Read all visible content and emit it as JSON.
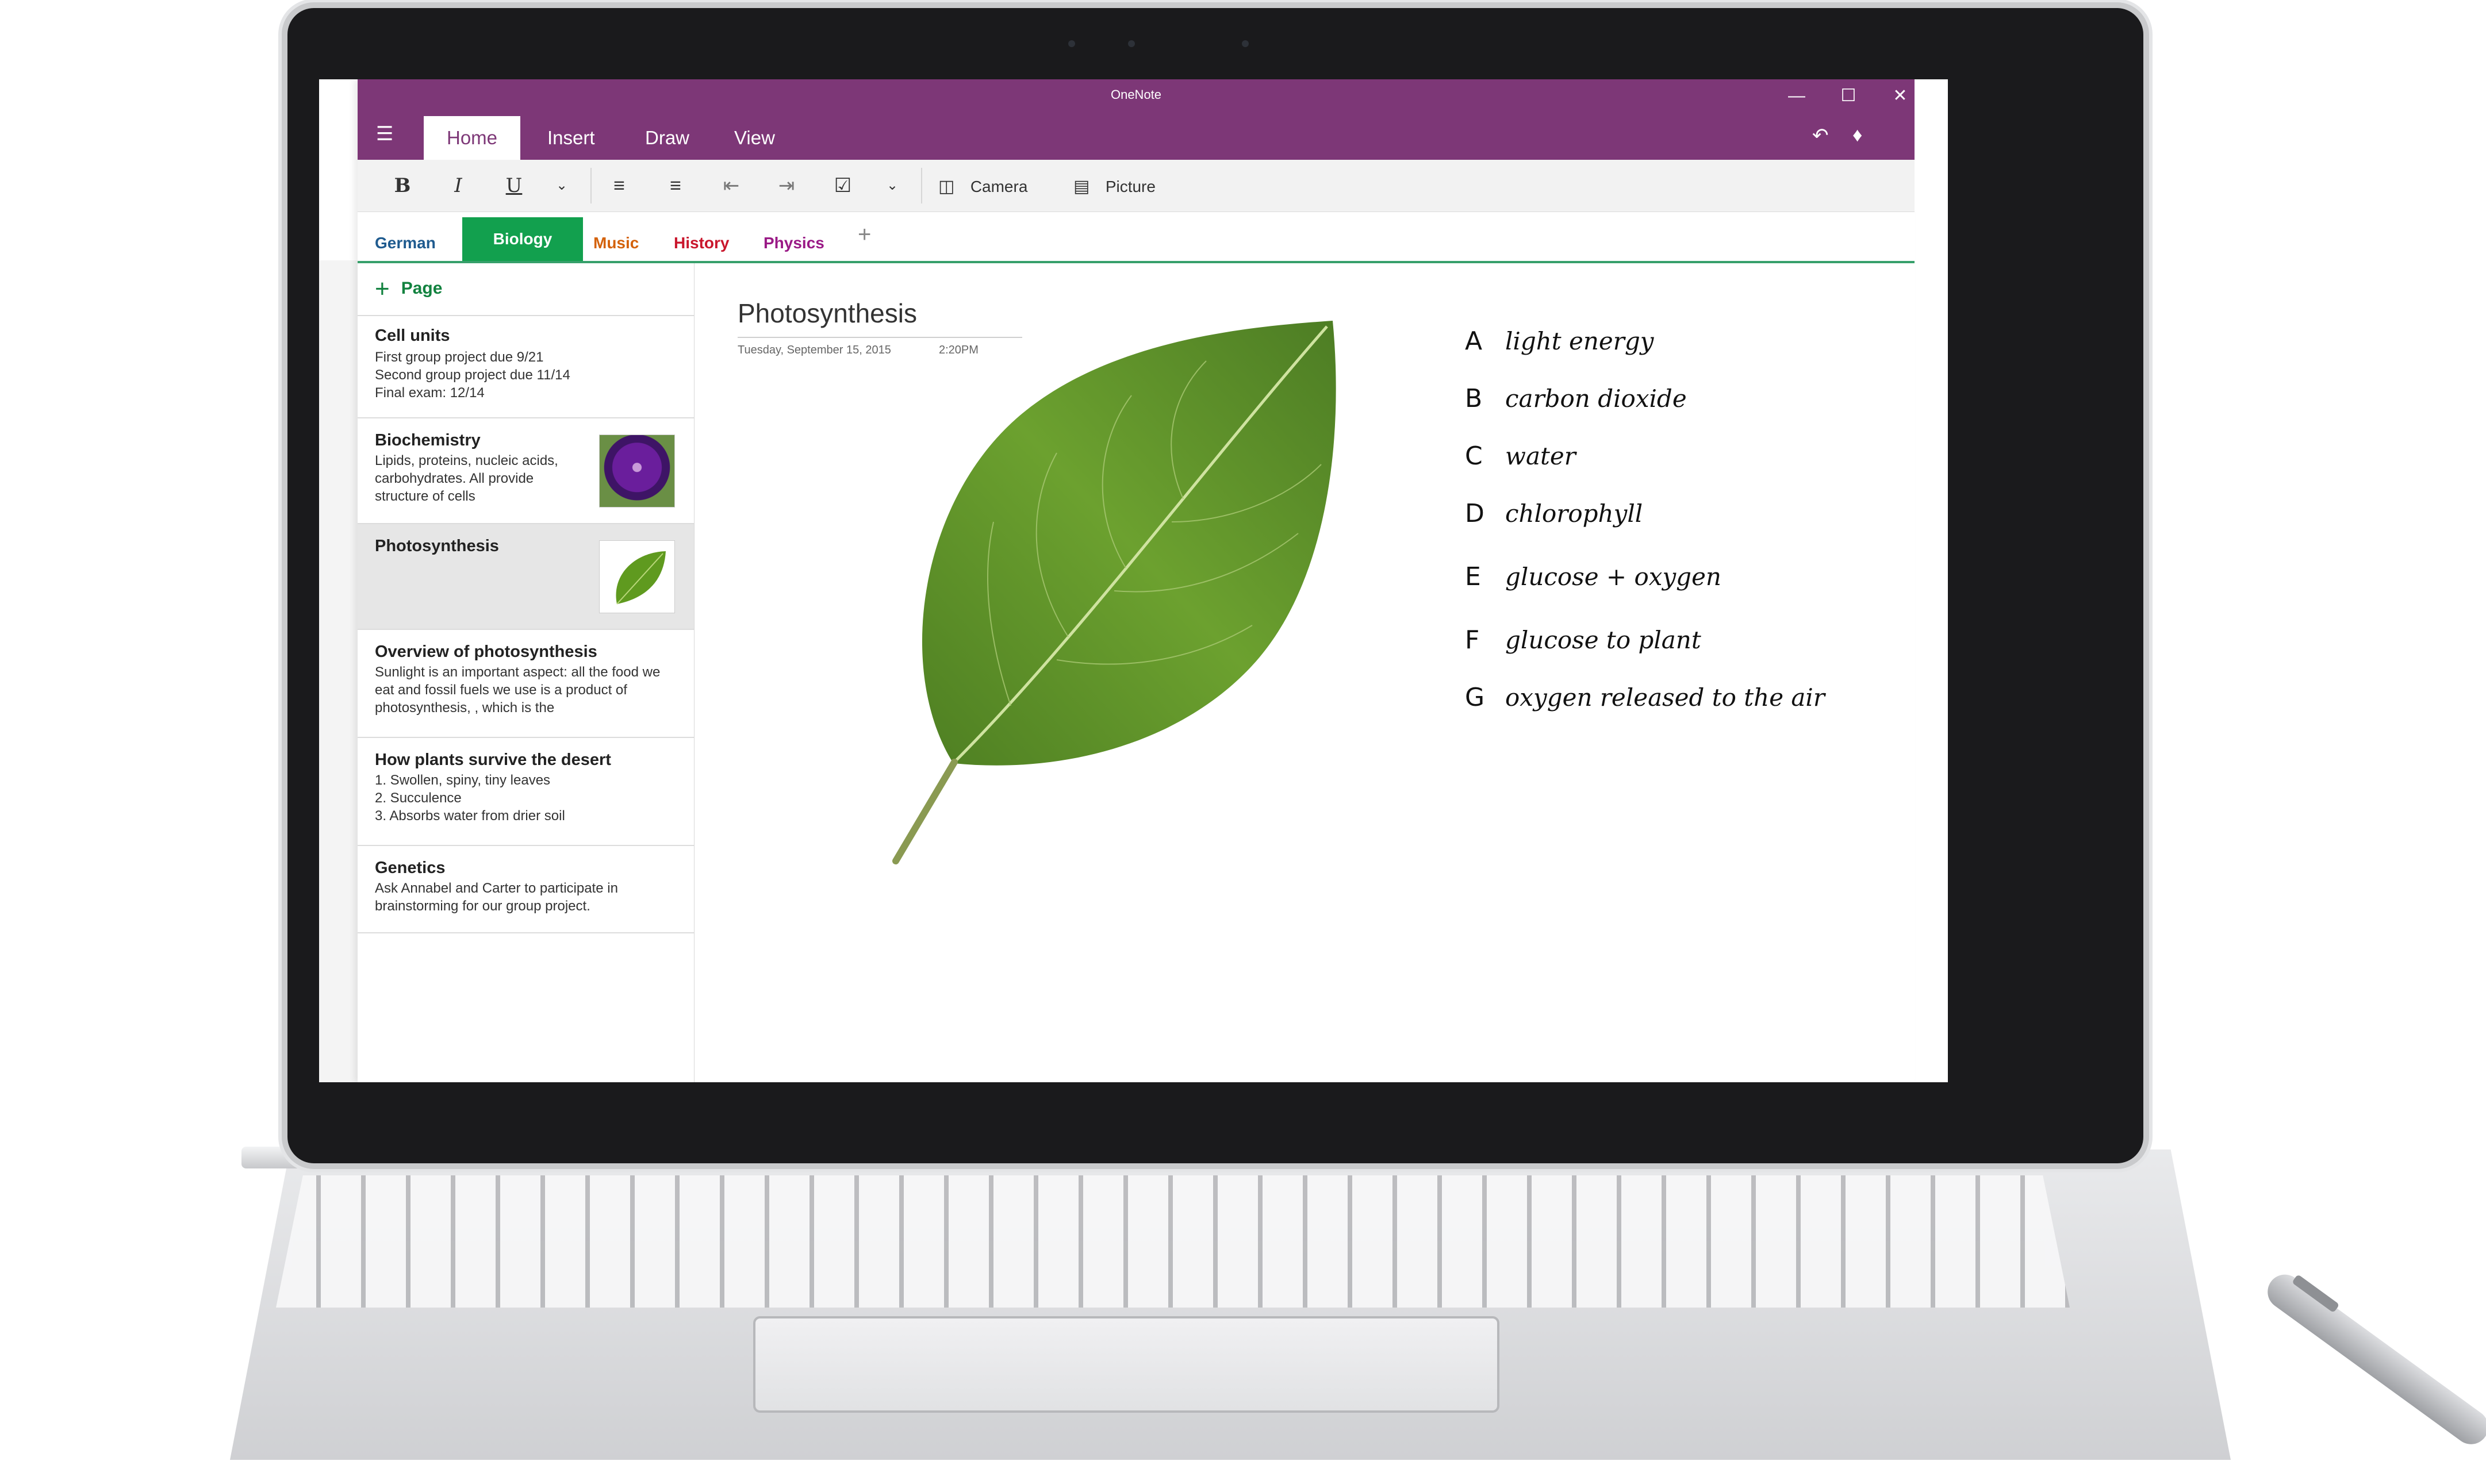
{
  "app": {
    "title": "OneNote"
  },
  "window_controls": {
    "minimize": "—",
    "maximize": "☐",
    "close": "✕"
  },
  "menu_tabs": [
    "Home",
    "Insert",
    "Draw",
    "View"
  ],
  "ribbon": {
    "bold": "B",
    "italic": "I",
    "underline": "U",
    "camera_label": "Camera",
    "picture_label": "Picture"
  },
  "sections": [
    {
      "label": "German",
      "color": "#1f5b8f"
    },
    {
      "label": "Biology",
      "color": "#12a04e"
    },
    {
      "label": "Music",
      "color": "#d4620b"
    },
    {
      "label": "History",
      "color": "#c9162c"
    },
    {
      "label": "Physics",
      "color": "#9a1a86"
    }
  ],
  "pages_panel": {
    "add_page_label": "Page",
    "items": [
      {
        "title": "Cell units",
        "body": "First group project due 9/21\nSecond group project due 11/14\nFinal exam: 12/14"
      },
      {
        "title": "Biochemistry",
        "body": "Lipids, proteins, nucleic acids, carbohydrates. All provide structure of cells"
      },
      {
        "title": "Photosynthesis",
        "body": ""
      },
      {
        "title": "Overview of photosynthesis",
        "body": "Sunlight is an important aspect: all the food we eat and fossil fuels we use is a product of photosynthesis, , which is the"
      },
      {
        "title": "How plants survive the desert",
        "body": "1. Swollen, spiny, tiny leaves\n2. Succulence\n3. Absorbs water from drier soil"
      },
      {
        "title": "Genetics",
        "body": "Ask Annabel and Carter to participate in brainstorming for our group project."
      }
    ]
  },
  "note": {
    "title": "Photosynthesis",
    "date": "Tuesday, September 15, 2015",
    "time": "2:20PM",
    "answers": [
      {
        "letter": "A",
        "text": "light energy"
      },
      {
        "letter": "B",
        "text": "carbon dioxide"
      },
      {
        "letter": "C",
        "text": "water"
      },
      {
        "letter": "D",
        "text": "chlorophyll"
      },
      {
        "letter": "E",
        "text": "glucose + oxygen"
      },
      {
        "letter": "F",
        "text": "glucose to plant"
      },
      {
        "letter": "G",
        "text": "oxygen released to the air"
      }
    ]
  },
  "colors": {
    "titlebar": "#7d3777",
    "active_section": "#12a04e",
    "section_rule": "#37a06b"
  }
}
